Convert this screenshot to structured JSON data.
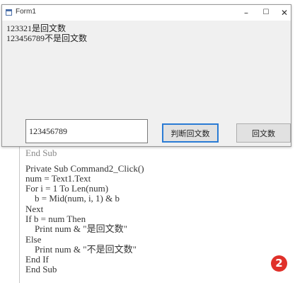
{
  "window": {
    "title": "Form1",
    "minimize": "–",
    "maximize": "☐",
    "close": "✕"
  },
  "output": [
    "123321是回文数",
    "123456789不是回文数"
  ],
  "input": {
    "value": "123456789"
  },
  "buttons": {
    "check": "判断回文数",
    "palindrome": "回文数"
  },
  "background_code_top": "End Sub",
  "code": [
    "Private Sub Command2_Click()",
    "num = Text1.Text",
    "For i = 1 To Len(num)",
    "    b = Mid(num, i, 1) & b",
    "Next",
    "If b = num Then",
    "    Print num & \"是回文数\"",
    "Else",
    "    Print num & \"不是回文数\"",
    "End If",
    "End Sub"
  ],
  "badge": "2",
  "colors": {
    "badge": "#e0302a",
    "focus": "#2a7bd4"
  }
}
